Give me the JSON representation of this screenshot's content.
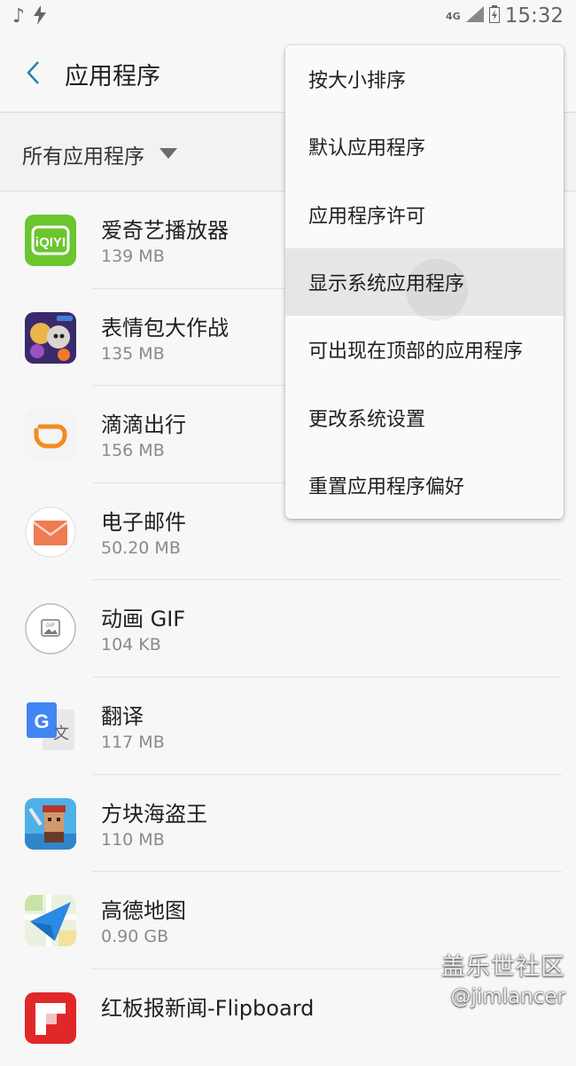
{
  "status": {
    "time": "15:32",
    "network": "4G"
  },
  "header": {
    "title": "应用程序"
  },
  "filter": {
    "label": "所有应用程序"
  },
  "apps": [
    {
      "name": "爱奇艺播放器",
      "size": "139 MB",
      "icon": "iqiyi-icon"
    },
    {
      "name": "表情包大作战",
      "size": "135 MB",
      "icon": "emoji-battle-icon"
    },
    {
      "name": "滴滴出行",
      "size": "156 MB",
      "icon": "didi-icon"
    },
    {
      "name": "电子邮件",
      "size": "50.20 MB",
      "icon": "email-icon"
    },
    {
      "name": "动画 GIF",
      "size": "104 KB",
      "icon": "gif-icon"
    },
    {
      "name": "翻译",
      "size": "117 MB",
      "icon": "translate-icon"
    },
    {
      "name": "方块海盗王",
      "size": "110 MB",
      "icon": "pirate-game-icon"
    },
    {
      "name": "高德地图",
      "size": "0.90 GB",
      "icon": "amap-icon"
    },
    {
      "name": "红板报新闻-Flipboard",
      "size": "",
      "icon": "flipboard-icon"
    }
  ],
  "menu": {
    "items": [
      "按大小排序",
      "默认应用程序",
      "应用程序许可",
      "显示系统应用程序",
      "可出现在顶部的应用程序",
      "更改系统设置",
      "重置应用程序偏好"
    ],
    "highlighted_index": 3
  },
  "watermark": {
    "line1": "盖乐世社区",
    "line2": "@jimlancer"
  },
  "colors": {
    "accent": "#1e88a8",
    "background": "#f7f7f7"
  }
}
